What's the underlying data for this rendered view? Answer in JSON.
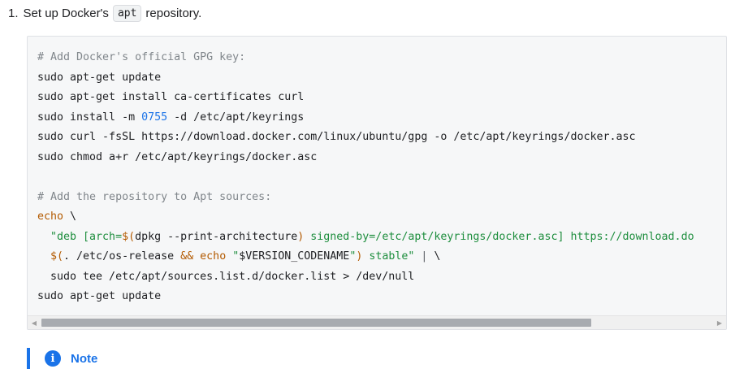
{
  "step": {
    "number": "1.",
    "text_before": "Set up Docker's",
    "inline_code": "apt",
    "text_after": "repository."
  },
  "code_lines": [
    [
      {
        "t": "# Add Docker's official GPG key:",
        "c": "comment"
      }
    ],
    [
      {
        "t": "sudo apt-get update",
        "c": "plain"
      }
    ],
    [
      {
        "t": "sudo apt-get install ca-certificates curl",
        "c": "plain"
      }
    ],
    [
      {
        "t": "sudo install -m ",
        "c": "plain"
      },
      {
        "t": "0755",
        "c": "num"
      },
      {
        "t": " -d /etc/apt/keyrings",
        "c": "plain"
      }
    ],
    [
      {
        "t": "sudo curl -fsSL https://download.docker.com/linux/ubuntu/gpg -o /etc/apt/keyrings/docker.asc",
        "c": "plain"
      }
    ],
    [
      {
        "t": "sudo chmod a+r /etc/apt/keyrings/docker.asc",
        "c": "plain"
      }
    ],
    [
      {
        "t": "",
        "c": "plain"
      }
    ],
    [
      {
        "t": "# Add the repository to Apt sources:",
        "c": "comment"
      }
    ],
    [
      {
        "t": "echo",
        "c": "kw"
      },
      {
        "t": " \\",
        "c": "plain"
      }
    ],
    [
      {
        "t": "  \"deb [arch=",
        "c": "str"
      },
      {
        "t": "$(",
        "c": "kw"
      },
      {
        "t": "dpkg --print-architecture",
        "c": "plain"
      },
      {
        "t": ")",
        "c": "kw"
      },
      {
        "t": " signed-by=/etc/apt/keyrings/docker.asc] https://download.do",
        "c": "str"
      }
    ],
    [
      {
        "t": "  ",
        "c": "plain"
      },
      {
        "t": "$(",
        "c": "kw"
      },
      {
        "t": ". /etc/os-release ",
        "c": "plain"
      },
      {
        "t": "&&",
        "c": "kw"
      },
      {
        "t": " ",
        "c": "plain"
      },
      {
        "t": "echo",
        "c": "kw"
      },
      {
        "t": " \"",
        "c": "str"
      },
      {
        "t": "$VERSION_CODENAME",
        "c": "plain"
      },
      {
        "t": "\"",
        "c": "str"
      },
      {
        "t": ")",
        "c": "kw"
      },
      {
        "t": " stable\"",
        "c": "str"
      },
      {
        "t": " | ",
        "c": "op"
      },
      {
        "t": "\\",
        "c": "plain"
      }
    ],
    [
      {
        "t": "  sudo tee /etc/apt/sources.list.d/docker.list > /dev/null",
        "c": "plain"
      }
    ],
    [
      {
        "t": "sudo apt-get update",
        "c": "plain"
      }
    ]
  ],
  "scrollbar": {
    "left_arrow": "◀",
    "right_arrow": "▶"
  },
  "note": {
    "icon_name": "info-icon",
    "icon_glyph": "i",
    "label": "Note"
  }
}
